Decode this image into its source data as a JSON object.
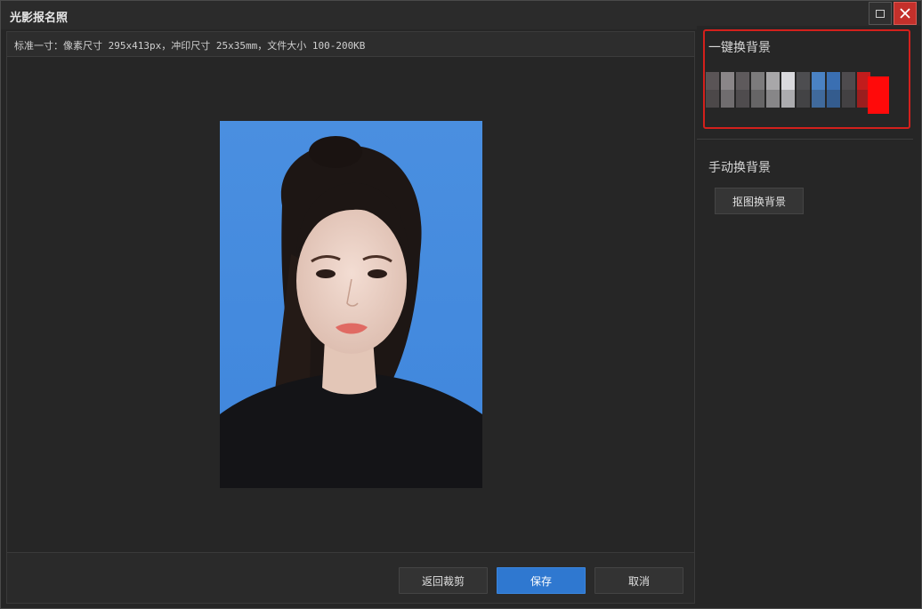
{
  "window": {
    "title": "光影报名照",
    "maximize_icon": "maximize-icon",
    "close_icon": "close-icon"
  },
  "info_bar": {
    "text": "标准一寸：像素尺寸 295x413px，冲印尺寸 25x35mm，文件大小 100-200KB"
  },
  "photo": {
    "background_color": "#4a8fe0",
    "description_icon": "portrait-photo"
  },
  "footer": {
    "back_crop_label": "返回裁剪",
    "save_label": "保存",
    "cancel_label": "取消"
  },
  "right_panel": {
    "one_click_title": "一键换背景",
    "manual_title": "手动换背景",
    "cutout_button_label": "抠图换背景",
    "swatches": [
      {
        "color": "#5a5456"
      },
      {
        "color": "#8a8688"
      },
      {
        "color": "#5e5a5c"
      },
      {
        "color": "#7c7b7c"
      },
      {
        "color": "#a8a7a9"
      },
      {
        "color": "#d9d9dd"
      },
      {
        "color": "#4d4d50"
      },
      {
        "color": "#4a82c4"
      },
      {
        "color": "#3a6fb2"
      },
      {
        "color": "#4e4b4e"
      },
      {
        "color": "#c21c1c"
      }
    ],
    "selected_color": "#ff0a0a",
    "highlight_color": "#d3201c"
  },
  "colors": {
    "accent": "#2f78d0",
    "close": "#c4302b"
  }
}
